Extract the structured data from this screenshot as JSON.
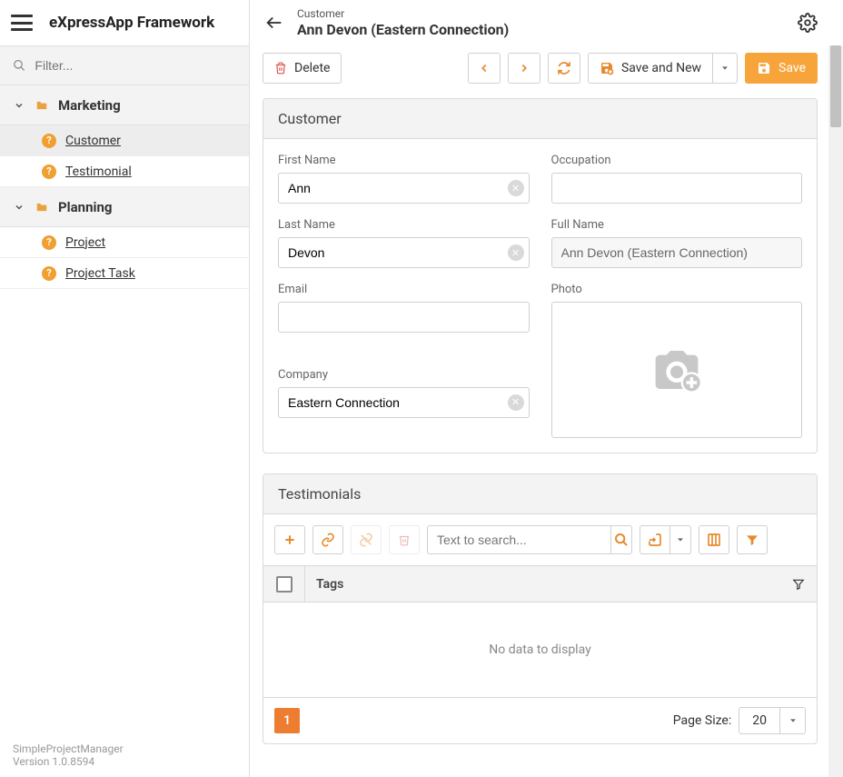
{
  "brand": "eXpressApp Framework",
  "filter_placeholder": "Filter...",
  "sidebar": {
    "groups": [
      {
        "label": "Marketing",
        "items": [
          {
            "label": "Customer",
            "active": true
          },
          {
            "label": "Testimonial"
          }
        ]
      },
      {
        "label": "Planning",
        "items": [
          {
            "label": "Project"
          },
          {
            "label": "Project Task"
          }
        ]
      }
    ]
  },
  "footer": {
    "app": "SimpleProjectManager",
    "version": "Version 1.0.8594"
  },
  "header": {
    "breadcrumb": "Customer",
    "title": "Ann Devon (Eastern Connection)"
  },
  "toolbar": {
    "delete": "Delete",
    "save_and_new": "Save and New",
    "save": "Save"
  },
  "customer_panel": {
    "title": "Customer",
    "fields": {
      "first_name_label": "First Name",
      "first_name": "Ann",
      "last_name_label": "Last Name",
      "last_name": "Devon",
      "email_label": "Email",
      "email": "",
      "company_label": "Company",
      "company": "Eastern Connection",
      "occupation_label": "Occupation",
      "occupation": "",
      "full_name_label": "Full Name",
      "full_name": "Ann Devon (Eastern Connection)",
      "photo_label": "Photo"
    }
  },
  "testimonials_panel": {
    "title": "Testimonials",
    "search_placeholder": "Text to search...",
    "column_tags": "Tags",
    "empty_text": "No data to display",
    "page": "1",
    "page_size_label": "Page Size:",
    "page_size": "20"
  }
}
